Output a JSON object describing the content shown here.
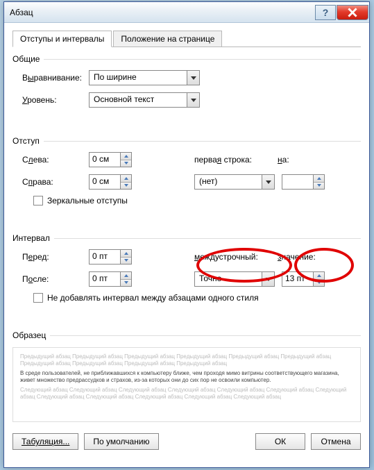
{
  "dialog": {
    "title": "Абзац",
    "help_aria": "Справка",
    "close_aria": "Закрыть"
  },
  "tabs": {
    "t1": "Отступы и интервалы",
    "t2": "Положение на странице"
  },
  "general": {
    "title": "Общие",
    "align_label_pre": "В",
    "align_label_u": "ы",
    "align_label_post": "равнивание:",
    "level_label_pre": "",
    "level_label_u": "У",
    "level_label_post": "ровень:",
    "align_value": "По ширине",
    "level_value": "Основной текст"
  },
  "indent": {
    "title": "Отступ",
    "left_pre": "С",
    "left_u": "л",
    "left_post": "ева:",
    "right_pre": "С",
    "right_u": "п",
    "right_post": "рава:",
    "left_value": "0 см",
    "right_value": "0 см",
    "firstline_pre": "перва",
    "firstline_u": "я",
    "firstline_post": " строка:",
    "on_u": "н",
    "on_post": "а:",
    "firstline_value": "(нет)",
    "on_value": "",
    "mirror_label": "Зеркальные отступы"
  },
  "spacing": {
    "title": "Интервал",
    "before_pre": "П",
    "before_u": "е",
    "before_post": "ред:",
    "after_pre": "П",
    "after_u": "о",
    "after_post": "сле:",
    "before_value": "0 пт",
    "after_value": "0 пт",
    "line_pre": "",
    "line_u": "м",
    "line_post": "еждустрочный:",
    "value_pre": "",
    "value_u": "з",
    "value_post": "начение:",
    "line_value": "Точно",
    "value_value": "13 пт",
    "nospace_label": "Не добавлять интервал между абзацами одного стиля"
  },
  "preview": {
    "title": "Образец",
    "grey_top": "Предыдущий абзац Предыдущий абзац Предыдущий абзац Предыдущий абзац Предыдущий абзац Предыдущий абзац Предыдущий абзац Предыдущий абзац Предыдущий абзац Предыдущий абзац",
    "sample": "В среде пользователей, не приближавшихся к компьютеру ближе, чем проходя мимо витрины соответствующего магазина, живет множество предрассудков и страхов, из-за которых они до сих пор не освоили компьютер.",
    "grey_bottom": "Следующий абзац Следующий абзац Следующий абзац Следующий абзац Следующий абзац Следующий абзац Следующий абзац Следующий абзац Следующий абзац Следующий абзац Следующий абзац Следующий абзац"
  },
  "buttons": {
    "tabs": "Табуляция...",
    "default": "По умолчанию",
    "ok": "ОК",
    "cancel": "Отмена"
  }
}
